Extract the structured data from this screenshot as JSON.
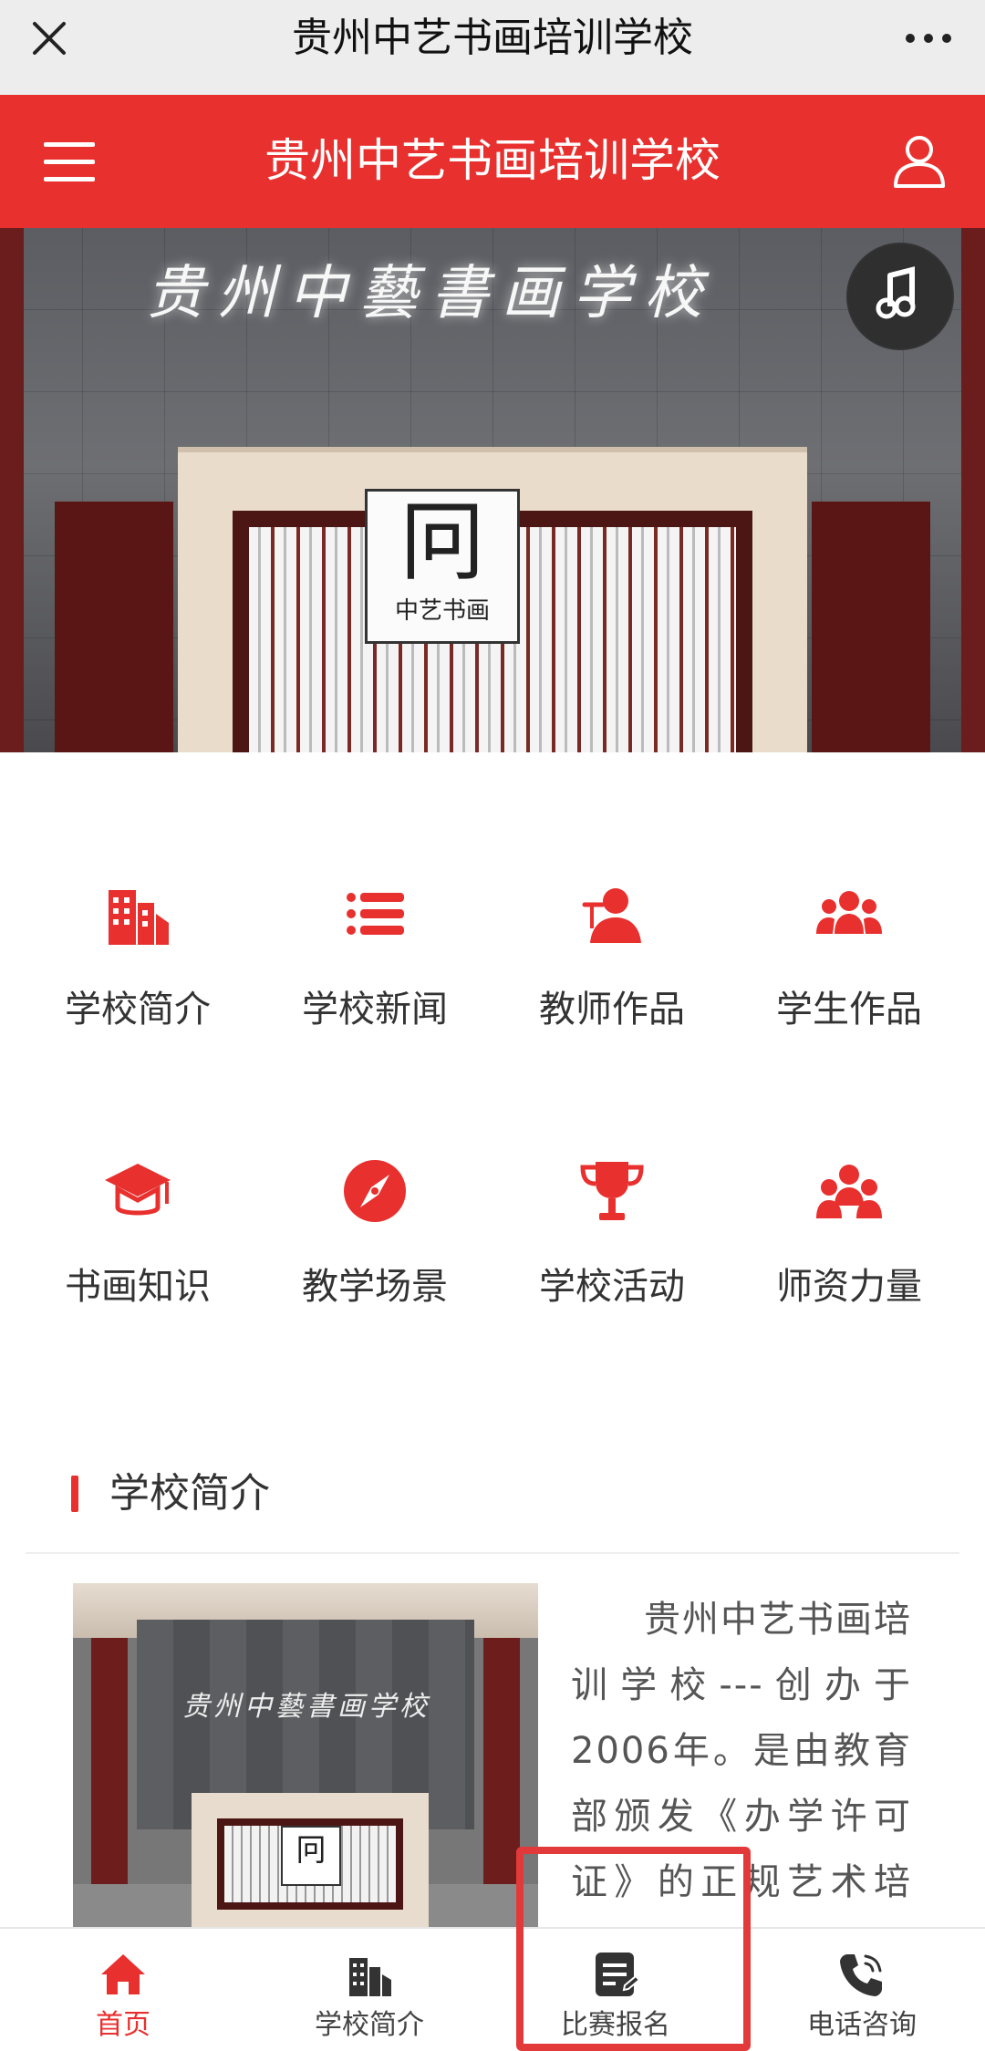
{
  "wechat_bar": {
    "title": "贵州中艺书画培训学校",
    "close_icon": "close-icon",
    "more_icon": "more-dots-icon"
  },
  "header": {
    "title": "贵州中艺书画培训学校",
    "menu_icon": "hamburger-menu-icon",
    "user_icon": "user-icon",
    "accent_color": "#e8302e"
  },
  "banner": {
    "sign_text": "贵州中藝書画学校",
    "logo_text": "中艺书画",
    "music_icon": "music-note-icon"
  },
  "categories": [
    {
      "label": "学校简介",
      "icon": "building-icon"
    },
    {
      "label": "学校新闻",
      "icon": "list-icon"
    },
    {
      "label": "教师作品",
      "icon": "teacher-icon"
    },
    {
      "label": "学生作品",
      "icon": "students-group-icon"
    },
    {
      "label": "书画知识",
      "icon": "graduation-cap-icon"
    },
    {
      "label": "教学场景",
      "icon": "compass-icon"
    },
    {
      "label": "学校活动",
      "icon": "trophy-icon"
    },
    {
      "label": "师资力量",
      "icon": "team-icon"
    }
  ],
  "intro_section": {
    "title": "学校简介",
    "text": "贵州中艺书画培训学校---创办于2006年。是由教育部颁发《办学许可证》的正规艺术培训学校，目前学校已有"
  },
  "tabbar": {
    "items": [
      {
        "label": "首页",
        "icon": "home-icon",
        "active": true
      },
      {
        "label": "学校简介",
        "icon": "building-icon",
        "active": false
      },
      {
        "label": "比赛报名",
        "icon": "form-document-icon",
        "active": false
      },
      {
        "label": "电话咨询",
        "icon": "phone-icon",
        "active": false
      }
    ]
  }
}
